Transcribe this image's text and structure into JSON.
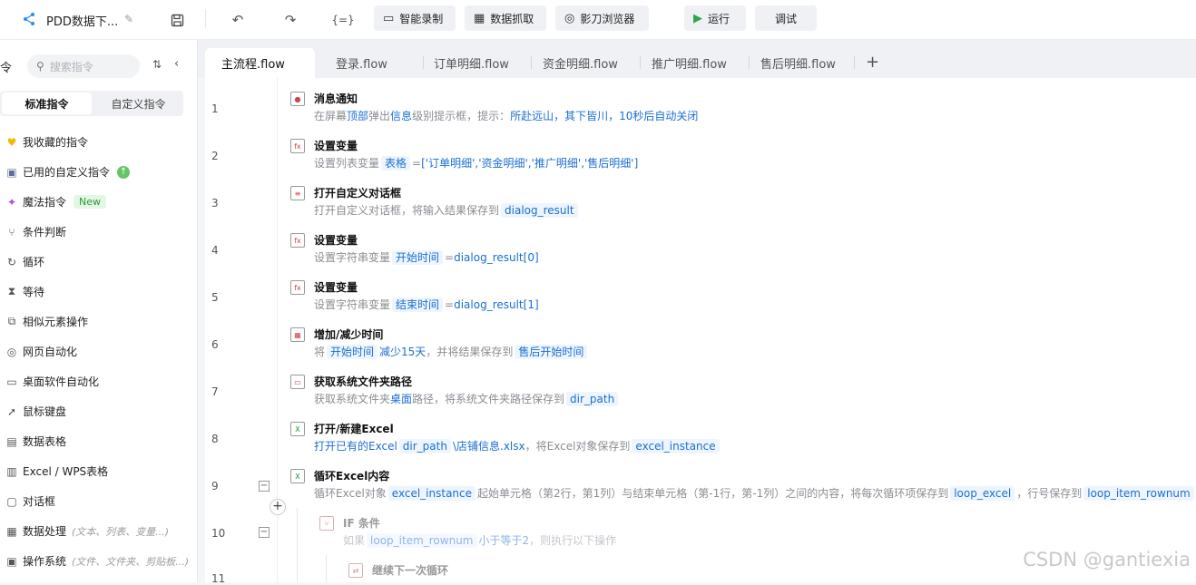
{
  "toolbar": {
    "title": "PDD数据下...",
    "format_label": "{=}",
    "record_label": "智能录制",
    "capture_label": "数据抓取",
    "browser_label": "影刀浏览器",
    "run_label": "运行",
    "debug_label": "调试"
  },
  "sidebar": {
    "header_char": "令",
    "search_placeholder": "搜索指令",
    "tabs": [
      "标准指令",
      "自定义指令"
    ],
    "new_badge": "New",
    "items": [
      {
        "label": "我收藏的指令",
        "icon": "heart-icon"
      },
      {
        "label": "已用的自定义指令",
        "icon": "calendar-icon"
      },
      {
        "label": "魔法指令",
        "icon": "sparkle-icon"
      },
      {
        "label": "条件判断",
        "icon": "branch-icon"
      },
      {
        "label": "循环",
        "icon": "loop-icon"
      },
      {
        "label": "等待",
        "icon": "hourglass-icon"
      },
      {
        "label": "相似元素操作",
        "icon": "copy-icon"
      },
      {
        "label": "网页自动化",
        "icon": "globe-icon"
      },
      {
        "label": "桌面软件自动化",
        "icon": "monitor-icon"
      },
      {
        "label": "鼠标键盘",
        "icon": "cursor-icon"
      },
      {
        "label": "数据表格",
        "icon": "table-icon"
      },
      {
        "label": "Excel / WPS表格",
        "icon": "excel-icon"
      },
      {
        "label": "对话框",
        "icon": "dialog-icon"
      },
      {
        "label": "数据处理",
        "icon": "data-icon",
        "sub": "(文本、列表、变量...)"
      },
      {
        "label": "操作系统",
        "icon": "os-icon",
        "sub": "(文件、文件夹、剪贴板...)"
      }
    ]
  },
  "tabs": [
    "主流程.flow",
    "登录.flow",
    "订单明细.flow",
    "资金明细.flow",
    "推广明细.flow",
    "售后明细.flow"
  ],
  "line_numbers": [
    "1",
    "2",
    "3",
    "4",
    "5",
    "6",
    "7",
    "8",
    "9",
    "10",
    "11"
  ],
  "steps": {
    "s1": {
      "title": "消息通知",
      "d": [
        "在屏幕",
        "顶部",
        "弹出",
        "信息",
        "级别提示框，提示：",
        "所赴远山，其下皆川，10秒后自动关闭"
      ]
    },
    "s2": {
      "title": "设置变量",
      "d": [
        "设置列表变量",
        "表格",
        "=",
        "['订单明细','资金明细','推广明细','售后明细']"
      ]
    },
    "s3": {
      "title": "打开自定义对话框",
      "d": [
        "打开自定义对话框，将输入结果保存到",
        "dialog_result"
      ]
    },
    "s4": {
      "title": "设置变量",
      "d": [
        "设置字符串变量",
        "开始时间",
        "=",
        "dialog_result[0]"
      ]
    },
    "s5": {
      "title": "设置变量",
      "d": [
        "设置字符串变量",
        "结束时间",
        "=",
        "dialog_result[1]"
      ]
    },
    "s6": {
      "title": "增加/减少时间",
      "d": [
        "将",
        "开始时间",
        "减少15天",
        "，并将结果保存到",
        "售后开始时间"
      ]
    },
    "s7": {
      "title": "获取系统文件夹路径",
      "d": [
        "获取系统文件夹",
        "桌面",
        "路径，将系统文件夹路径保存到",
        "dir_path"
      ]
    },
    "s8": {
      "title": "打开/新建Excel",
      "d": [
        "打开已有的Excel",
        "dir_path",
        "\\店铺信息.xlsx",
        "，将Excel对象保存到",
        "excel_instance"
      ]
    },
    "s9": {
      "title": "循环Excel内容",
      "d": [
        "循环Excel对象",
        "excel_instance",
        "起始单元格（第2行，第1列）与结束单元格（第-1行，第-1列）之间的内容，将每次循环项保存到",
        "loop_excel",
        "，行号保存到",
        "loop_item_rownum"
      ]
    },
    "s10": {
      "title": "IF 条件",
      "d": [
        "如果",
        "loop_item_rownum",
        "小于等于2",
        "，则执行以下操作"
      ]
    },
    "s11": {
      "title": "继续下一次循环"
    }
  },
  "watermark": "CSDN @gantiexia"
}
